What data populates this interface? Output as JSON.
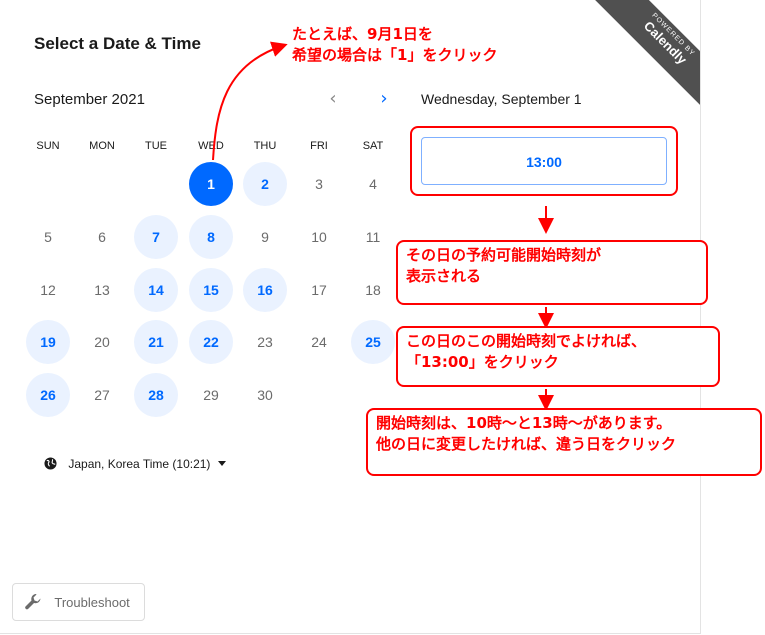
{
  "header": {
    "title": "Select a Date & Time"
  },
  "calendar": {
    "month_label": "September 2021",
    "prev_icon": "‹",
    "next_icon": "›",
    "weekdays": [
      "SUN",
      "MON",
      "TUE",
      "WED",
      "THU",
      "FRI",
      "SAT"
    ],
    "days": {
      "d1": "1",
      "d2": "2",
      "d3": "3",
      "d4": "4",
      "d5": "5",
      "d6": "6",
      "d7": "7",
      "d8": "8",
      "d9": "9",
      "d10": "10",
      "d11": "11",
      "d12": "12",
      "d13": "13",
      "d14": "14",
      "d15": "15",
      "d16": "16",
      "d17": "17",
      "d18": "18",
      "d19": "19",
      "d20": "20",
      "d21": "21",
      "d22": "22",
      "d23": "23",
      "d24": "24",
      "d25": "25",
      "d26": "26",
      "d27": "27",
      "d28": "28",
      "d29": "29",
      "d30": "30"
    },
    "selected_day": "1",
    "available_days": [
      "1",
      "2",
      "7",
      "8",
      "14",
      "15",
      "16",
      "19",
      "21",
      "22",
      "25",
      "26",
      "28"
    ]
  },
  "timezone": {
    "label": "Japan, Korea Time (10:21)"
  },
  "times": {
    "date_heading": "Wednesday, September 1",
    "slots": [
      "13:00"
    ]
  },
  "ribbon": {
    "small": "POWERED BY",
    "brand": "Calendly"
  },
  "troubleshoot": {
    "label": "Troubleshoot"
  },
  "annotations": {
    "top_line1": "たとえば、9月1日を",
    "top_line2": "希望の場合は「1」をクリック",
    "callout1_line1": "その日の予約可能開始時刻が",
    "callout1_line2": "表示される",
    "callout2_line1": "この日のこの開始時刻でよければ、",
    "callout2_line2": "「13:00」をクリック",
    "callout3_line1": "開始時刻は、10時～と13時～があります。",
    "callout3_line2": "他の日に変更したければ、違う日をクリック"
  },
  "colors": {
    "accent": "#0069ff",
    "available_bg": "#eaf2ff",
    "annotation": "#ff0000",
    "ribbon": "#505050"
  }
}
